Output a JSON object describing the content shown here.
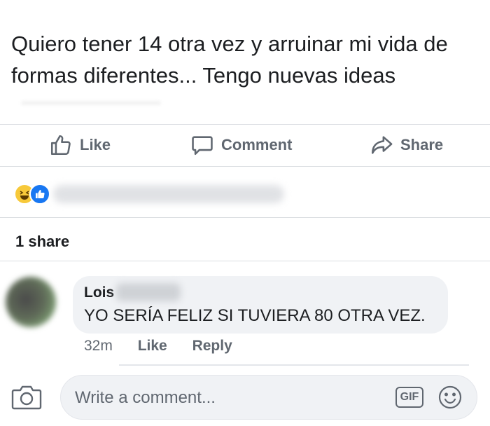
{
  "post": {
    "text": "Quiero tener 14 otra vez y arruinar mi vida de formas diferentes... Tengo nuevas ideas"
  },
  "actions": {
    "like_label": "Like",
    "comment_label": "Comment",
    "share_label": "Share"
  },
  "reactions": {
    "icons": [
      "haha-emoji-icon",
      "like-reaction-icon"
    ]
  },
  "shares": {
    "count_label": "1 share"
  },
  "comment": {
    "author": "Lois",
    "text": "YO SERÍA FELIZ SI TUVIERA 80 OTRA VEZ.",
    "time": "32m",
    "like_label": "Like",
    "reply_label": "Reply"
  },
  "composer": {
    "placeholder": "Write a comment...",
    "gif_label": "GIF",
    "icons": [
      "camera-icon",
      "gif-icon",
      "smiley-icon"
    ]
  },
  "colors": {
    "text": "#1c1e21",
    "muted": "#606770",
    "bubble": "#f0f2f5",
    "brand_blue": "#1877f2",
    "haha_yellow": "#f7c93a"
  }
}
